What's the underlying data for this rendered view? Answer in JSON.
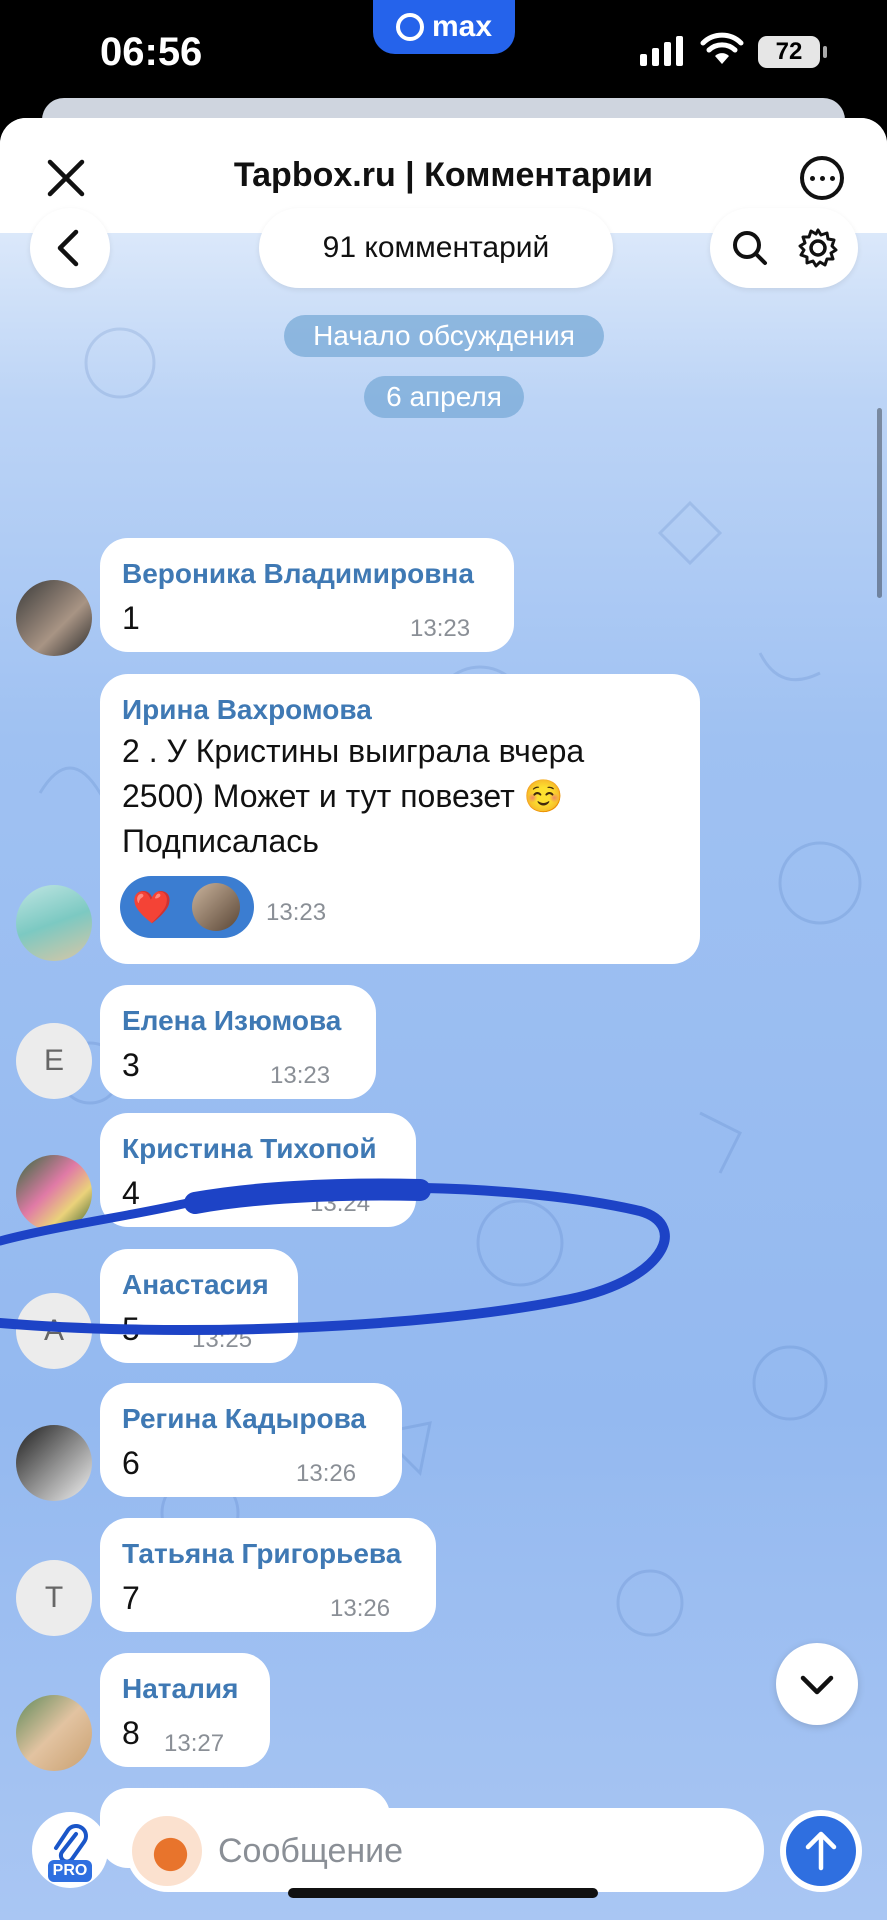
{
  "status": {
    "time": "06:56",
    "app_name": "max",
    "battery": "72"
  },
  "header": {
    "title": "Tapbox.ru | Комментарии",
    "close_icon": "close-icon",
    "more_icon": "more-icon"
  },
  "toolbar": {
    "count_label": "91 комментарий",
    "icons": [
      "back-icon",
      "search-icon",
      "gear-icon"
    ]
  },
  "system": {
    "start": "Начало обсуждения",
    "date": "6 апреля"
  },
  "messages": [
    {
      "author": "Вероника Владимировна",
      "text": "1",
      "time": "13:23"
    },
    {
      "author": "Ирина Вахромова",
      "text": "2 . У Кристины выиграла вчера 2500) Может и тут повезет ☺️ Подписалась",
      "line1": "2 . У Кристины выиграла вчера",
      "line2": "2500) Может и тут повезет ☺️",
      "line3": "Подписалась",
      "time": "13:23",
      "reaction": "❤️"
    },
    {
      "author": "Елена Изюмова",
      "text": "3",
      "time": "13:23",
      "avatar_letter": "Е"
    },
    {
      "author": "Кристина Тихопой",
      "text": "4",
      "time": "13:24"
    },
    {
      "author": "Анастасия",
      "text": "5",
      "time": "13:25",
      "avatar_letter": "А"
    },
    {
      "author": "Регина Кадырова",
      "text": "6",
      "time": "13:26"
    },
    {
      "author": "Татьяна Григорьева",
      "text": "7",
      "time": "13:26",
      "avatar_letter": "Т"
    },
    {
      "author": "Наталия",
      "text": "8",
      "time": "13:27"
    }
  ],
  "composer": {
    "placeholder": "Сообщение",
    "pro_label": "PRO"
  },
  "colors": {
    "accent": "#2f6fe0",
    "author": "#3f79b4",
    "annotation": "#1d43c6"
  }
}
